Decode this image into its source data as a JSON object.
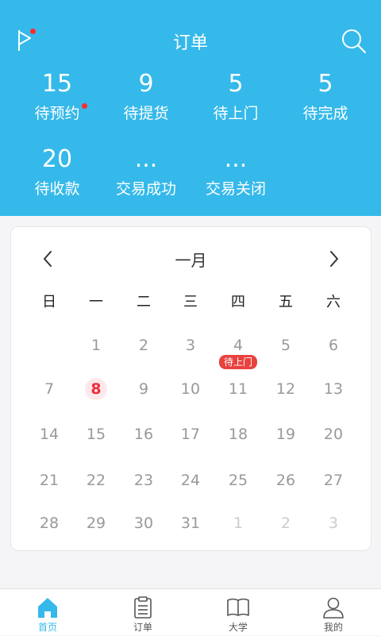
{
  "header": {
    "title": "订单",
    "bg_color": "#35b9ea"
  },
  "stats": [
    {
      "value": "15",
      "label": "待预约",
      "dot": true
    },
    {
      "value": "9",
      "label": "待提货",
      "dot": false
    },
    {
      "value": "5",
      "label": "待上门",
      "dot": false
    },
    {
      "value": "5",
      "label": "待完成",
      "dot": false
    },
    {
      "value": "20",
      "label": "待收款",
      "dot": false
    },
    {
      "value": "...",
      "label": "交易成功",
      "dot": false
    },
    {
      "value": "...",
      "label": "交易关闭",
      "dot": false
    }
  ],
  "calendar": {
    "month": "一月",
    "weekdays": [
      "日",
      "一",
      "二",
      "三",
      "四",
      "五",
      "六"
    ],
    "weeks": [
      [
        "",
        "1",
        "2",
        "3",
        "4",
        "5",
        "6"
      ],
      [
        "7",
        "8",
        "9",
        "10",
        "11",
        "12",
        "13"
      ],
      [
        "14",
        "15",
        "16",
        "17",
        "18",
        "19",
        "20"
      ],
      [
        "21",
        "22",
        "23",
        "24",
        "25",
        "26",
        "27"
      ],
      [
        "28",
        "29",
        "30",
        "31",
        "1",
        "2",
        "3"
      ]
    ],
    "today": "8",
    "event": {
      "day": "4",
      "label": "待上门"
    },
    "today_color": "#ee2d3a",
    "badge_color": "#e8423e"
  },
  "tabbar": [
    {
      "label": "首页",
      "icon": "home-icon",
      "active": true
    },
    {
      "label": "订单",
      "icon": "clipboard-icon",
      "active": false
    },
    {
      "label": "大学",
      "icon": "book-icon",
      "active": false
    },
    {
      "label": "我的",
      "icon": "user-icon",
      "active": false
    }
  ]
}
